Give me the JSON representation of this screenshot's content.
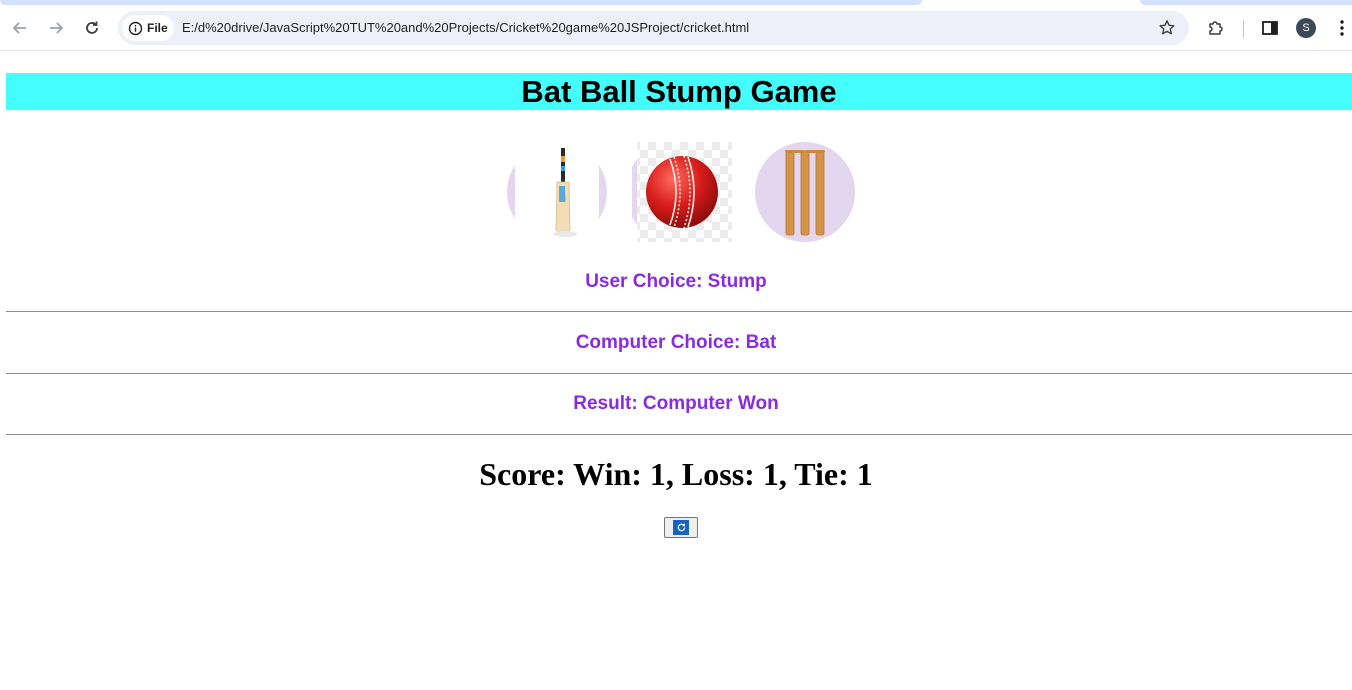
{
  "browser": {
    "chip_label": "File",
    "url": "E:/d%20drive/JavaScript%20TUT%20and%20Projects/Cricket%20game%20JSProject/cricket.html",
    "profile_initial": "S"
  },
  "page": {
    "title": "Bat Ball Stump Game",
    "user_choice": "User Choice: Stump",
    "computer_choice": "Computer Choice: Bat",
    "result": "Result: Computer Won",
    "score": "Score: Win: 1, Loss: 1, Tie: 1"
  },
  "choices": [
    {
      "name": "bat"
    },
    {
      "name": "ball"
    },
    {
      "name": "stump"
    }
  ],
  "colors": {
    "title_bg": "#44fefd",
    "text_accent": "#8a2be2"
  }
}
